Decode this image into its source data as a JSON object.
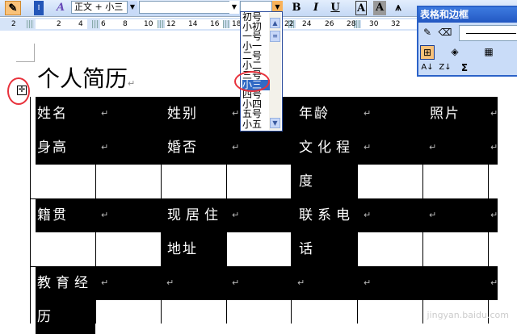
{
  "toolbar": {
    "style_box": "正文 + 小三",
    "font_box": "",
    "size_box": "",
    "bold": "B",
    "italic": "I",
    "underline": "U",
    "char_border": "A",
    "char_shading": "A"
  },
  "ruler": {
    "ticks": [
      "2",
      "2",
      "4",
      "6",
      "8",
      "10",
      "12",
      "14",
      "16",
      "18",
      "22",
      "24",
      "26",
      "28",
      "30",
      "32"
    ]
  },
  "font_size_dropdown": {
    "items": [
      "初号",
      "小初",
      "一号",
      "小一",
      "二号",
      "小二",
      "三号",
      "小三",
      "四号",
      "小四",
      "五号",
      "小五"
    ],
    "selected": "小三"
  },
  "tables_borders_toolbar": {
    "title": "表格和边框",
    "sum": "Σ",
    "sort_asc": "A↓",
    "sort_desc": "Z↓"
  },
  "document": {
    "title": "个人简历",
    "return_mark": "↵",
    "cells": {
      "name": "姓名",
      "gender": "姓别",
      "age": "年龄",
      "photo": "照片",
      "height": "身高",
      "married": "婚否",
      "education_1": "文化程",
      "education_2": "度",
      "native": "籍贯",
      "address_1": "现居住",
      "address_2": "地址",
      "phone_1": "联系电",
      "phone_2": "话",
      "experience_1": "教育经",
      "experience_2": "历"
    }
  },
  "watermark": "jingyan.baidu.com",
  "colors": {
    "accent": "#316ac5",
    "highlight_circle": "#e8323c",
    "toolbar": "#c4d8f5"
  }
}
